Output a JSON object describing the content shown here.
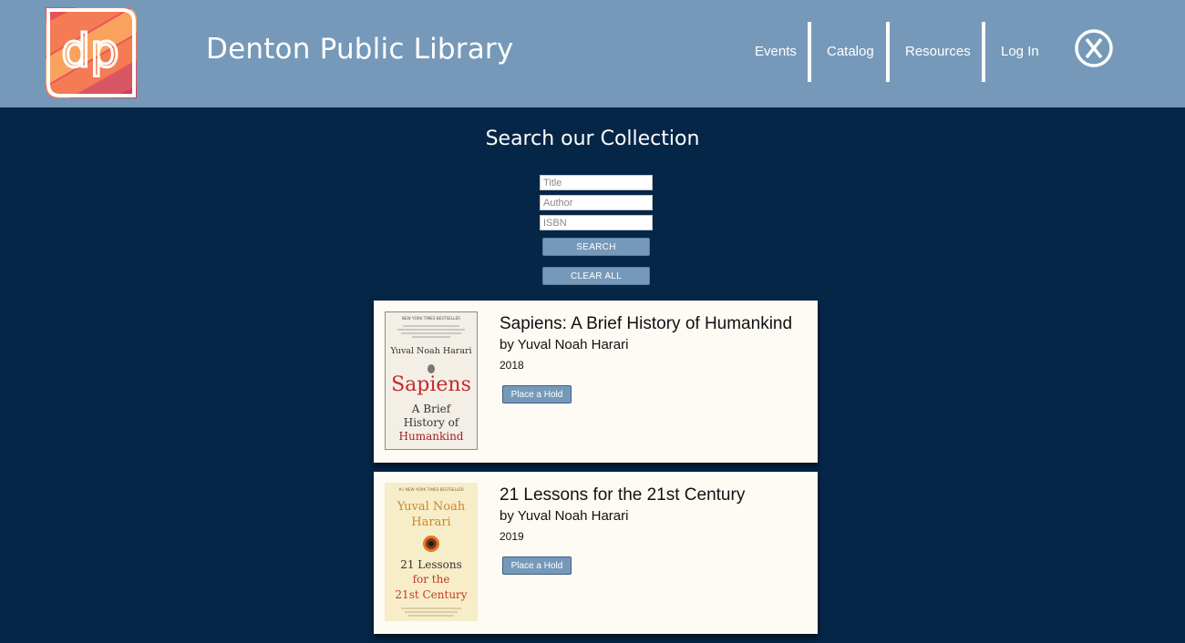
{
  "header": {
    "title": "Denton Public Library",
    "logo_text": "dp",
    "nav": [
      {
        "label": "Events"
      },
      {
        "label": "Catalog"
      },
      {
        "label": "Resources"
      },
      {
        "label": "Log In"
      }
    ],
    "close_icon": "close-circle-x-icon",
    "background": "#7699b9"
  },
  "search": {
    "heading": "Search our Collection",
    "title_placeholder": "Title",
    "author_placeholder": "Author",
    "isbn_placeholder": "ISBN",
    "search_label": "SEARCH",
    "clear_label": "CLEAR ALL"
  },
  "results": [
    {
      "title": "Sapiens: A Brief History of Humankind",
      "author": "by Yuval Noah Harari",
      "year": "2018",
      "hold_label": "Place a Hold",
      "cover": {
        "banner": "NEW YORK TIMES BESTSELLER",
        "author": "Yuval Noah Harari",
        "title": "Sapiens",
        "subtitle_line1": "A Brief",
        "subtitle_line2": "History of",
        "subtitle_line3": "Humankind"
      }
    },
    {
      "title": "21 Lessons for the 21st Century",
      "author": "by Yuval Noah Harari",
      "year": "2019",
      "hold_label": "Place a Hold",
      "cover": {
        "banner": "#1 NEW YORK TIMES BESTSELLER",
        "author_line1": "Yuval Noah",
        "author_line2": "Harari",
        "title_line1": "21 Lessons",
        "title_line2": "for the",
        "title_line3": "21st Century"
      }
    }
  ],
  "colors": {
    "page_background": "#052646",
    "accent": "#7699b9",
    "card_background": "#fdfbf4"
  }
}
